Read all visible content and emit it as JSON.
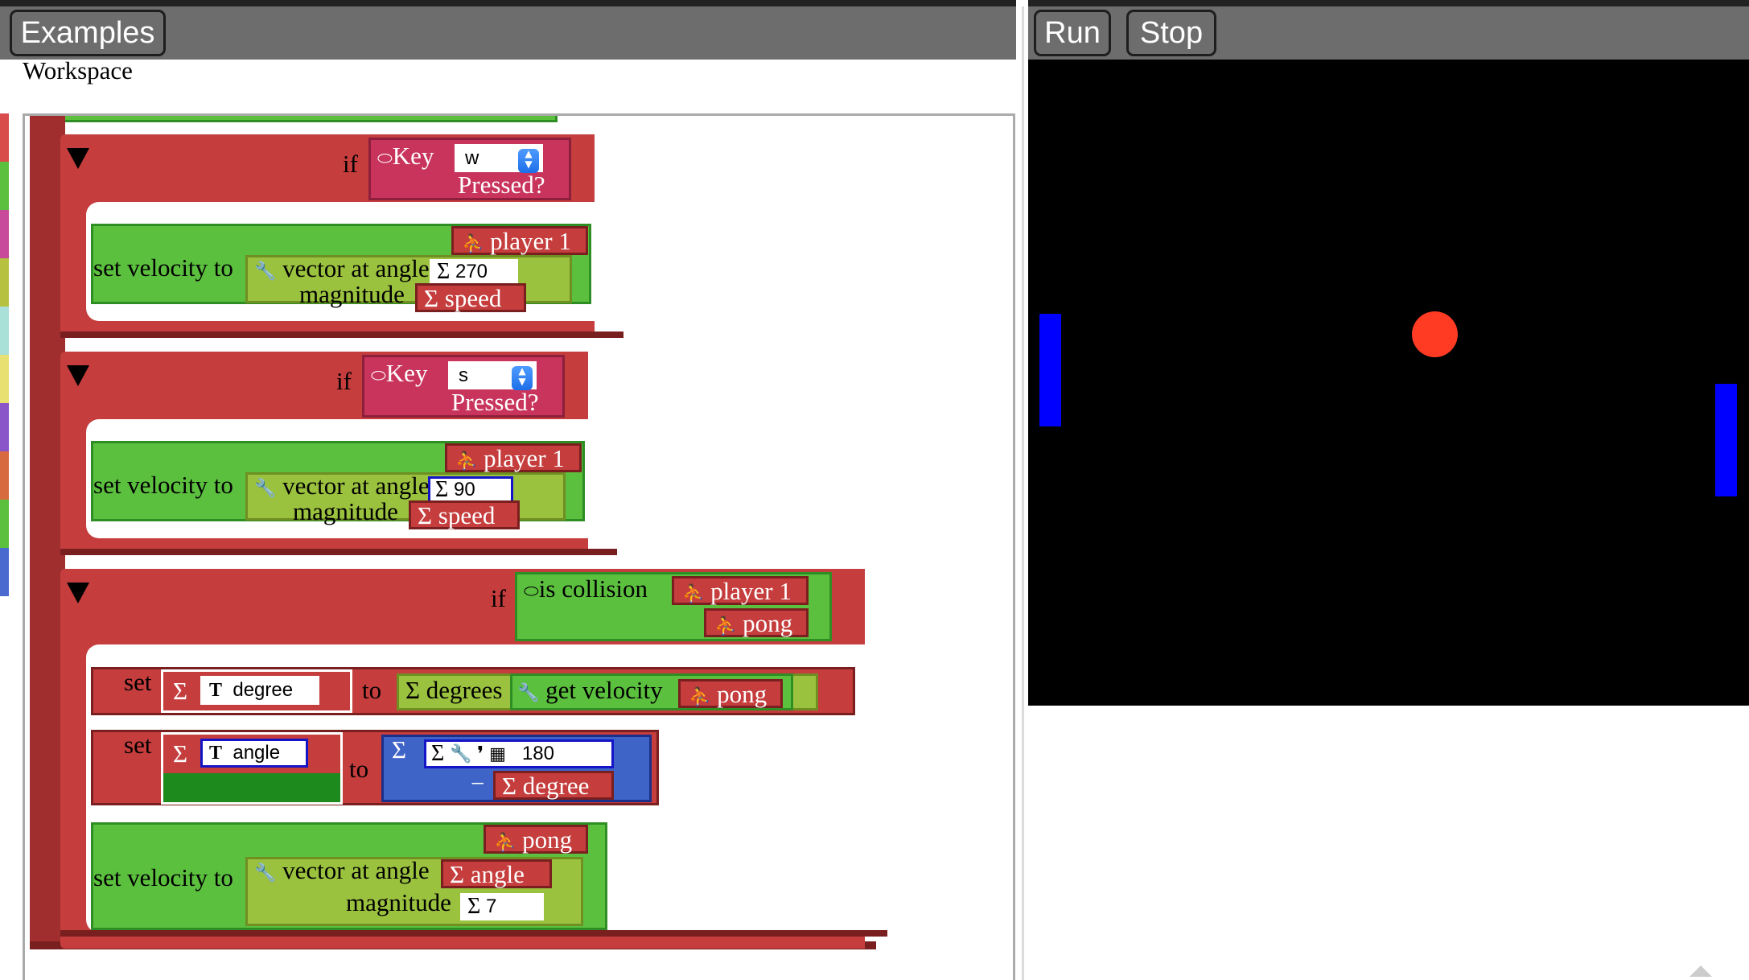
{
  "toolbar": {
    "examples_label": "Examples",
    "run_label": "Run",
    "stop_label": "Stop"
  },
  "workspace": {
    "title": "Workspace"
  },
  "palette_colors": [
    "#d94c4c",
    "#5cc03f",
    "#c84a9a",
    "#b6c23f",
    "#a9e0d8",
    "#e8e070",
    "#8a55c8",
    "#d86a40",
    "#5cc03f",
    "#4a6ad0"
  ],
  "blocks": {
    "if_label": "if",
    "key_w": {
      "label": "Key",
      "value": "w",
      "pressed": "Pressed?"
    },
    "key_s": {
      "label": "Key",
      "value": "s",
      "pressed": "Pressed?"
    },
    "set_velocity_label": "set velocity to",
    "vector_label": "vector at angle",
    "magnitude_label": "magnitude",
    "player_label": "player 1",
    "speed_label": "speed",
    "angle_270": "270",
    "angle_90": "90",
    "collision_label": "is collision",
    "pong_label": "pong",
    "set_label": "set",
    "to_label": "to",
    "degree_var": "degree",
    "angle_var": "angle",
    "degrees_label": "degrees",
    "get_velocity_label": "get velocity",
    "value_180": "180",
    "minus_label": "−",
    "degree_label": "degree",
    "angle_label": "angle",
    "magnitude_7": "7",
    "sigma": "Σ",
    "T": "T"
  },
  "colors": {
    "paddle": "#0000ff",
    "ball": "#ff3b24",
    "stage_bg": "#000000"
  }
}
